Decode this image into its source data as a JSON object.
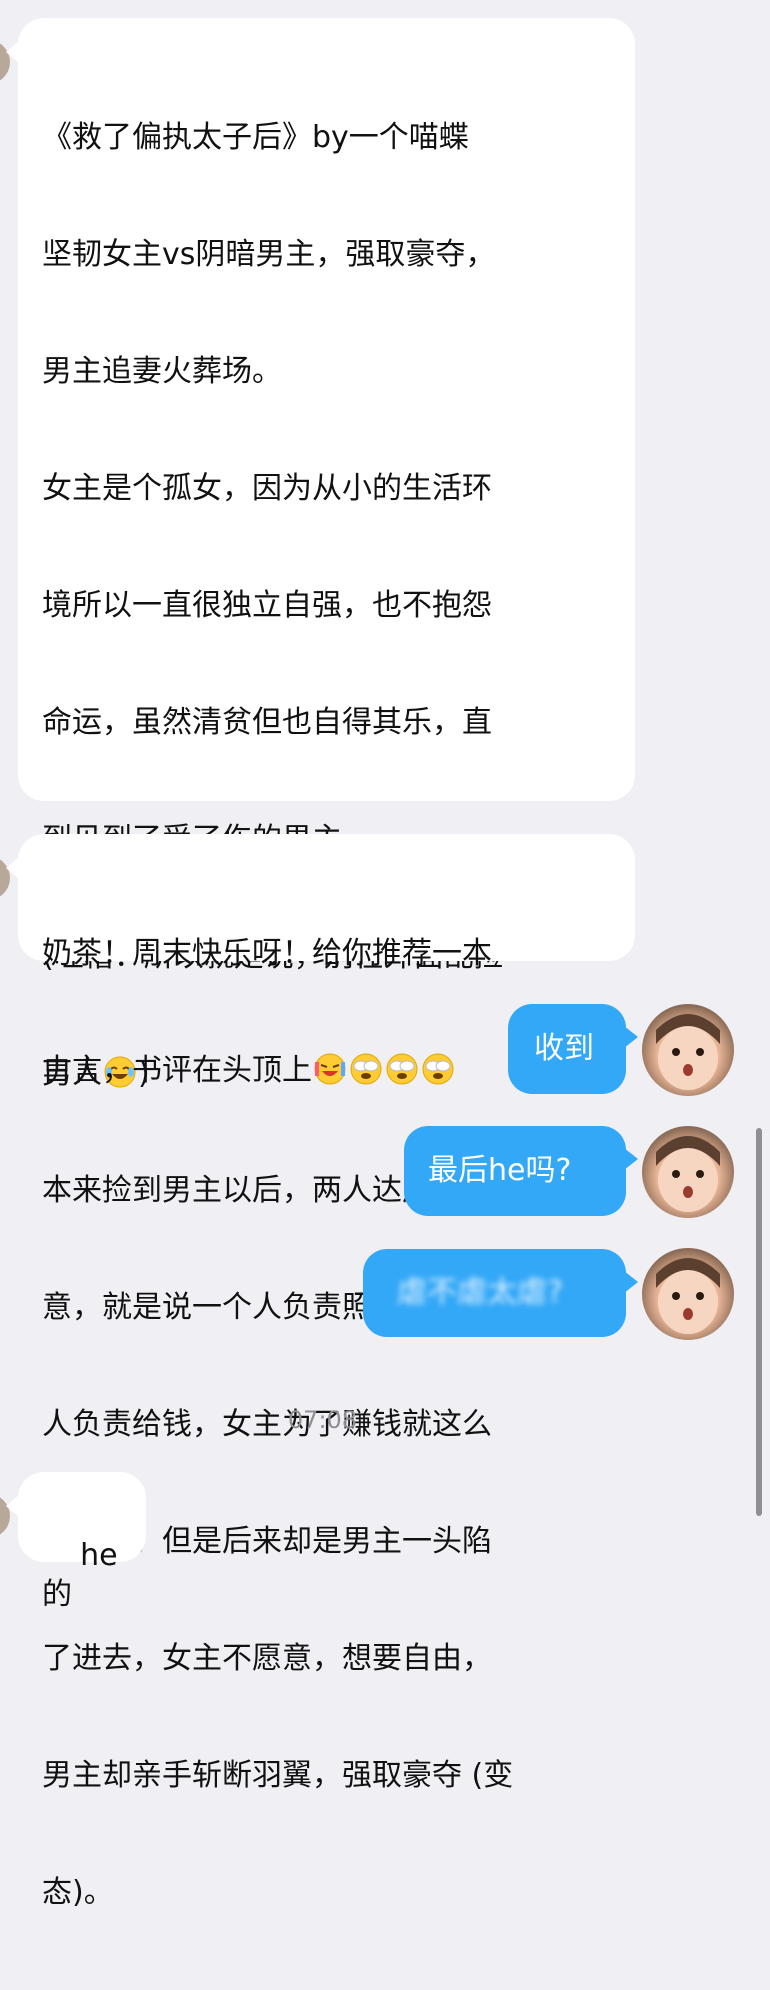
{
  "messages": [
    {
      "id": "incoming-1",
      "direction": "incoming",
      "lines": [
        "《救了偏执太子后》by一个喵蝶",
        "坚韧女主vs阴暗男主，强取豪夺，",
        "男主追妻火葬场。",
        "女主是个孤女，因为从小的生活环",
        "境所以一直很独立自强，也不抱怨",
        "命运，虽然清贫但也自得其乐，直",
        "到见到了受了伤的男主。",
        "(吐槽：所以就是说，别在外面乱捡",
        "男人",
        "本来捡到男主以后，两人达成合",
        "意，就是说一个人负责照顾，一个",
        "人负责给钱，女主为了赚钱就这么",
        "同意了。但是后来却是男主一头陷",
        "了进去，女主不愿意，想要自由，",
        "男主却亲手斩断羽翼，强取豪夺 (变",
        "态)。"
      ],
      "line9_suffix": ")",
      "emoji_line9": "laughing-crying-emoji"
    },
    {
      "id": "incoming-2",
      "direction": "incoming",
      "lines": [
        "奶茶！周末快乐呀！给你推荐一本",
        "古言，书评在头顶上"
      ],
      "emojis": [
        "laughing-crying-emoji",
        "covering-face-emoji",
        "covering-face-emoji",
        "covering-face-emoji"
      ]
    },
    {
      "id": "outgoing-1",
      "direction": "outgoing",
      "text": "收到"
    },
    {
      "id": "outgoing-2",
      "direction": "outgoing",
      "text": "最后he吗?"
    },
    {
      "id": "outgoing-3",
      "direction": "outgoing",
      "text": "虐不虐太虐?",
      "blurred": true
    },
    {
      "id": "incoming-3",
      "direction": "incoming",
      "text": "he的"
    }
  ],
  "timestamp": "07:08",
  "colors": {
    "background": "#efeff4",
    "incoming_bubble": "#ffffff",
    "outgoing_bubble": "#33a8f7",
    "timestamp": "#8e8e93"
  }
}
